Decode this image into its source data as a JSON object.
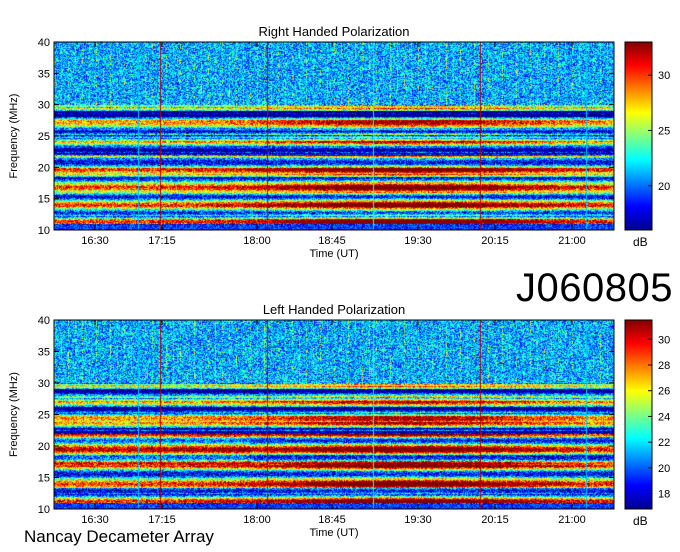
{
  "figure": {
    "observation_id": "J060805",
    "instrument": "Nancay Decameter Array"
  },
  "chart_data": [
    {
      "type": "heatmap",
      "title": "Right Handed Polarization",
      "xlabel": "Time (UT)",
      "ylabel": "Frequency (MHz)",
      "x_ticks": [
        "16:30",
        "17:15",
        "18:00",
        "18:45",
        "19:30",
        "20:15",
        "21:00"
      ],
      "y_ticks": [
        10,
        15,
        20,
        25,
        30,
        35,
        40
      ],
      "ylim": [
        10,
        40
      ],
      "colorbar": {
        "label": "dB",
        "ticks": [
          20,
          25,
          30
        ],
        "range": [
          16,
          33
        ]
      },
      "colormap": "jet"
    },
    {
      "type": "heatmap",
      "title": "Left Handed Polarization",
      "xlabel": "Time (UT)",
      "ylabel": "Frequency (MHz)",
      "x_ticks": [
        "16:30",
        "17:15",
        "18:00",
        "18:45",
        "19:30",
        "20:15",
        "21:00"
      ],
      "y_ticks": [
        10,
        15,
        20,
        25,
        30,
        35,
        40
      ],
      "ylim": [
        10,
        40
      ],
      "colorbar": {
        "label": "dB",
        "ticks": [
          18,
          20,
          22,
          24,
          26,
          28,
          30
        ],
        "range": [
          16.8,
          31.5
        ]
      },
      "colormap": "jet"
    }
  ]
}
